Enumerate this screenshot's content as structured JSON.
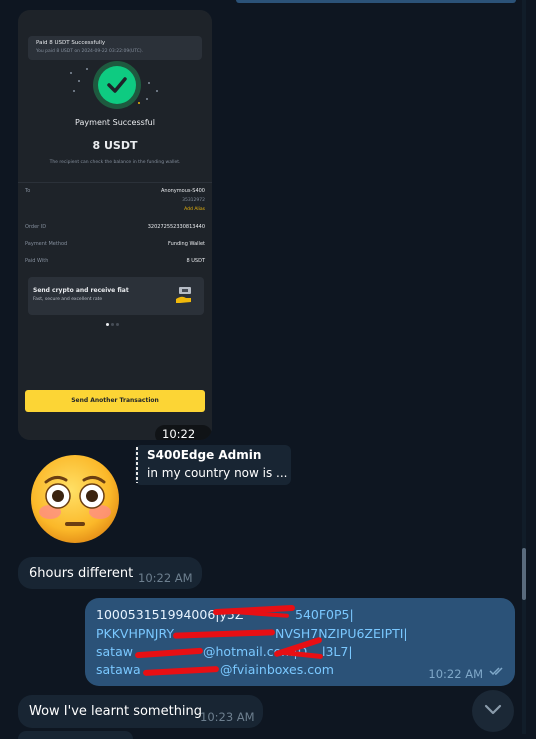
{
  "receipt": {
    "notif_title": "Paid 8 USDT Successfully",
    "notif_sub": "You paid 8 USDT on 2024-09-22 03:22:09(UTC).",
    "title": "Payment Successful",
    "amount": "8 USDT",
    "note": "The recipient can check the balance in the funding wallet.",
    "rows": [
      {
        "label": "To",
        "value": "Anonymous-S400",
        "sub": "35312972",
        "link": "Add Alias"
      },
      {
        "label": "Order ID",
        "value": "320272552330813440"
      },
      {
        "label": "Payment Method",
        "value": "Funding Wallet"
      },
      {
        "label": "Paid With",
        "value": "8 USDT"
      }
    ],
    "promo_title": "Send crypto and receive fiat",
    "promo_sub": "Fast, secure and excellent rate",
    "button": "Send Another Transaction"
  },
  "messages": {
    "photo_time": "10:22 AM",
    "reply_name": "S400Edge Admin",
    "reply_text": "in my country now is ...",
    "msg1_text": "6hours different",
    "msg1_time": "10:22 AM",
    "out_lines": [
      "100053151994006|y5Z",
      "540F0P5|",
      "PKKVHPNJRY",
      "NVSH7NZIPU6ZEIPTI|",
      "sataw",
      "@hotmail.com|D",
      "l3L7|",
      "satawa",
      "@fviainboxes.com"
    ],
    "out_time": "10:22 AM",
    "msg2_text": "Wow I've learnt something",
    "msg2_time": "10:23 AM"
  },
  "icons": {
    "emoji": "flushed-face-emoji",
    "read": "double-check-icon",
    "scroll": "chevron-down-icon"
  },
  "colors": {
    "chat_bg": "#0e1621",
    "incoming": "#182533",
    "outgoing": "#2b5278",
    "link": "#7ac8ff",
    "binance_yellow": "#fcd535",
    "success_green": "#0ecb81"
  }
}
